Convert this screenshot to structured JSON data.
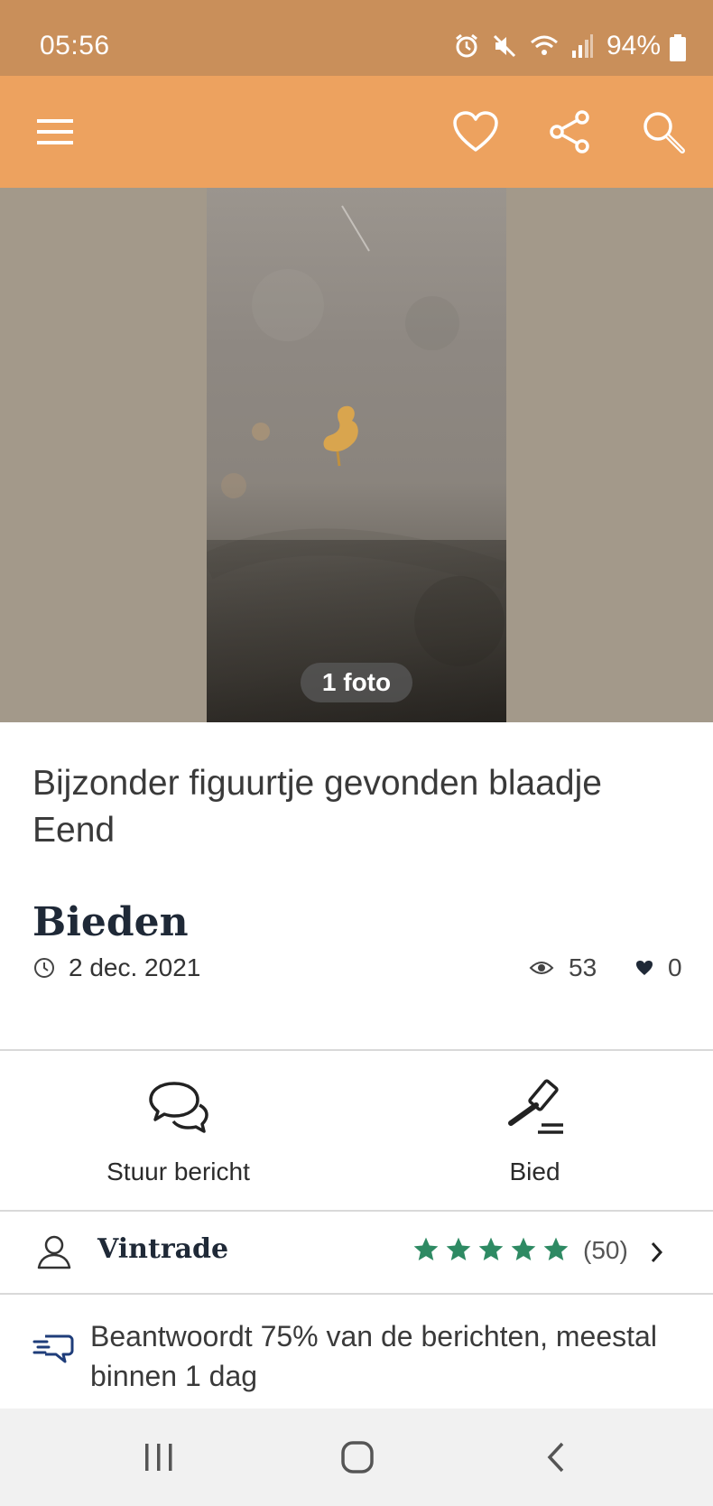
{
  "status_bar": {
    "time": "05:56",
    "battery": "94%"
  },
  "app_bar": {
    "icons": [
      "menu-icon",
      "heart-icon",
      "share-icon",
      "search-icon"
    ]
  },
  "photo": {
    "count_label": "1 foto"
  },
  "listing": {
    "title": "Bijzonder figuurtje gevonden blaadje Eend",
    "price": "Bieden",
    "date": "2 dec. 2021",
    "views": "53",
    "likes": "0"
  },
  "actions": {
    "message_label": "Stuur bericht",
    "bid_label": "Bied"
  },
  "seller": {
    "name": "Vintrade",
    "rating_count": "(50)",
    "rating_stars": 5
  },
  "response": {
    "text": "Beantwoordt 75% van de berichten, meestal binnen 1 dag"
  },
  "colors": {
    "status_bar": "#c98f5a",
    "app_bar": "#eda25f",
    "stars": "#2e8a63",
    "photo_backdrop": "#a3998a"
  }
}
